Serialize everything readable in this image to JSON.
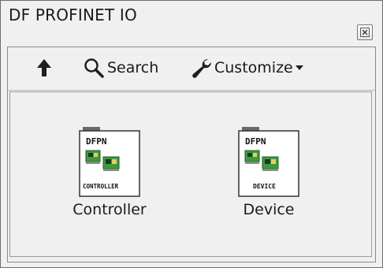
{
  "palette": {
    "title": "DF PROFINET IO"
  },
  "toolbar": {
    "search_label": "Search",
    "customize_label": "Customize"
  },
  "items": [
    {
      "label": "Controller",
      "icon_top": "DFPN",
      "icon_bottom": "CONTROLLER"
    },
    {
      "label": "Device",
      "icon_top": "DFPN",
      "icon_bottom": "DEVICE"
    }
  ],
  "colors": {
    "background": "#f0f0f0",
    "border": "#6d6d6d",
    "card_green": "#3f9a3f"
  }
}
